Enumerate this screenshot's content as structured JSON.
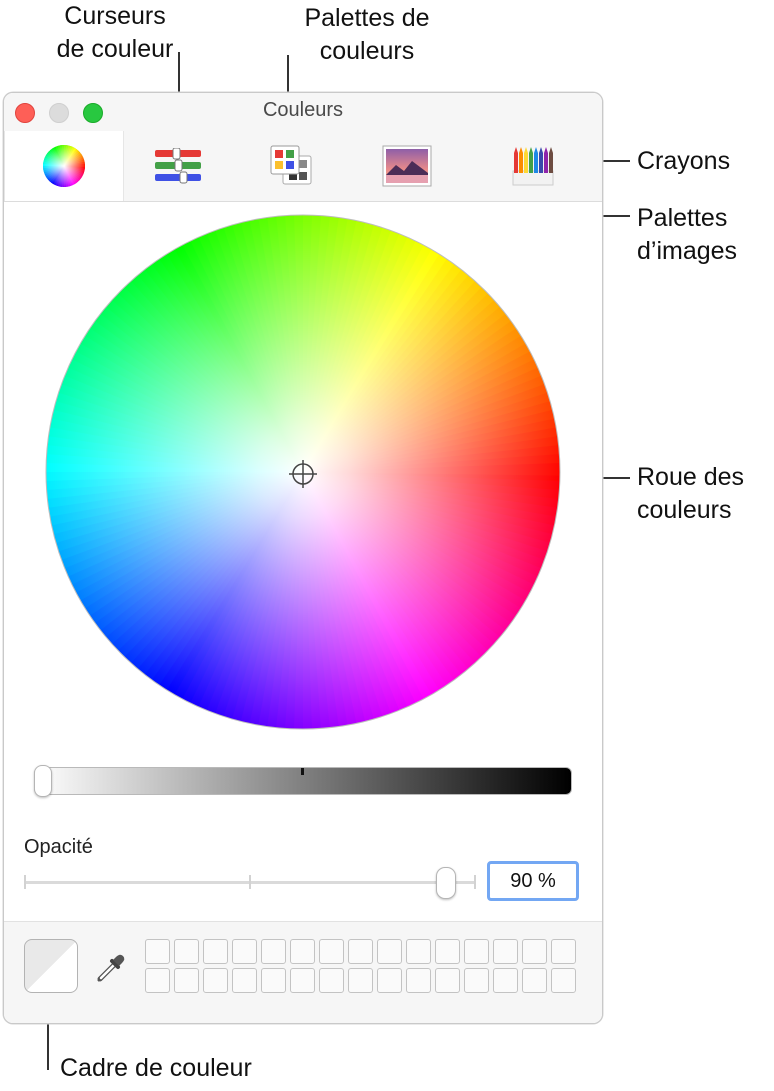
{
  "callouts": {
    "sliders": [
      "Curseurs",
      "de couleur"
    ],
    "palettes": [
      "Palettes de",
      "couleurs"
    ],
    "crayons": "Crayons",
    "image_palettes": [
      "Palettes",
      "d’images"
    ],
    "wheel": [
      "Roue des",
      "couleurs"
    ],
    "color_well": "Cadre de couleur"
  },
  "window": {
    "title": "Couleurs",
    "tabs": [
      {
        "name": "color-wheel-tab",
        "icon": "color-wheel-icon",
        "selected": true
      },
      {
        "name": "color-sliders-tab",
        "icon": "sliders-icon",
        "selected": false
      },
      {
        "name": "color-palettes-tab",
        "icon": "palettes-icon",
        "selected": false
      },
      {
        "name": "image-palettes-tab",
        "icon": "image-icon",
        "selected": false
      },
      {
        "name": "crayons-tab",
        "icon": "crayons-icon",
        "selected": false
      }
    ],
    "brightness_level": 0,
    "opacity": {
      "label": "Opacité",
      "value": "90 %",
      "fraction": 0.9
    },
    "swatch_grid": {
      "rows": 2,
      "columns": 15
    },
    "colors": {
      "close": "#fe5f57",
      "minimize": "#dcdcdc",
      "zoom": "#28c840",
      "focus_ring": "#73a7f3"
    }
  }
}
